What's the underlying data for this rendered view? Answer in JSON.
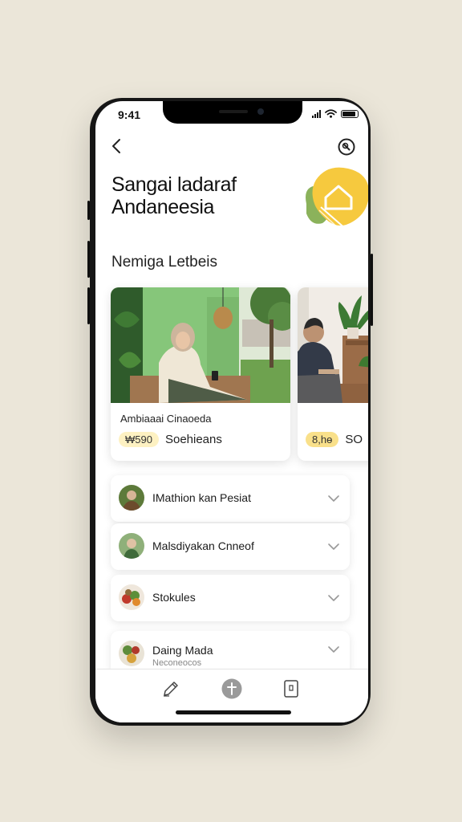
{
  "status_bar": {
    "time": "9:41"
  },
  "header": {
    "title_line1": "Sangai ladaraf",
    "title_line2": "Andaneesia"
  },
  "section": {
    "title": "Nemiga Letbeis"
  },
  "cards": [
    {
      "caption": "Ambiaaai Cinaoeda",
      "price": "₩590",
      "label": "Soehieans"
    },
    {
      "caption": "",
      "price": "8,hɵ",
      "label": "SO"
    }
  ],
  "list_items": [
    {
      "label": "IMathion kan Pesiat",
      "sub": ""
    },
    {
      "label": "Malsdiyakan Cnneof",
      "sub": ""
    },
    {
      "label": "Stokules",
      "sub": ""
    },
    {
      "label": "Daing Mada",
      "sub": "Neconeocos"
    }
  ],
  "icons": {
    "back": "chevron-left-icon",
    "search": "search-icon",
    "edit": "pencil-icon",
    "add": "plus-icon",
    "doc": "document-icon",
    "house": "house-icon",
    "chevron": "chevron-down-icon"
  },
  "colors": {
    "background": "#ebe6d9",
    "accent_yellow": "#f6c93e",
    "accent_green": "#8bb25b",
    "pill": "#fdf1c2"
  }
}
